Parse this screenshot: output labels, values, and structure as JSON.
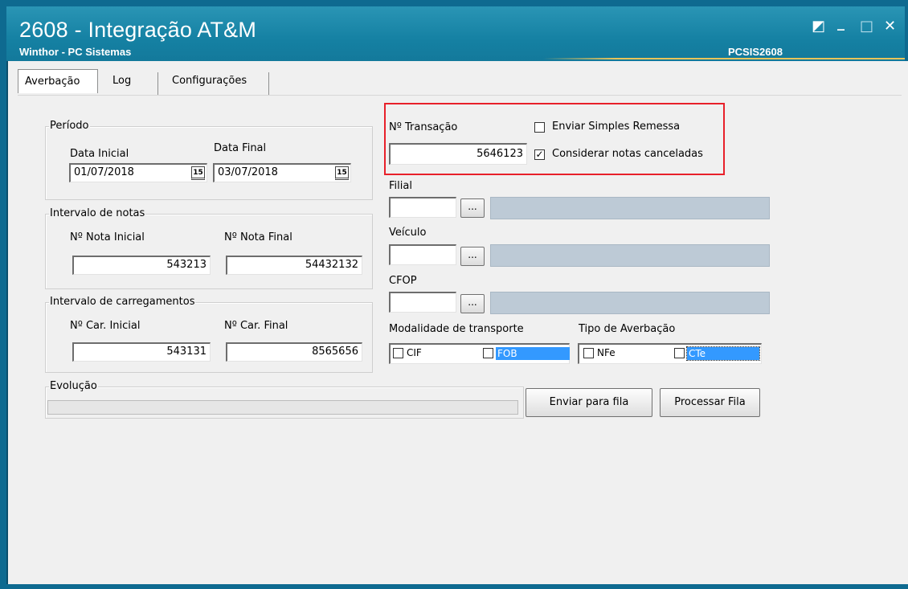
{
  "window": {
    "title": "2608 - Integração AT&M",
    "subtitle": "Winthor - PC Sistemas",
    "code": "PCSIS2608",
    "controls": {
      "restore": "◩",
      "minimize": "_",
      "maximize": "□",
      "close": "✕"
    }
  },
  "tabs": [
    {
      "label": "Averbação",
      "active": true
    },
    {
      "label": "Log",
      "active": false
    },
    {
      "label": "Configurações",
      "active": false
    }
  ],
  "periodo": {
    "legend": "Período",
    "data_inicial_label": "Data Inicial",
    "data_inicial_value": "01/07/2018",
    "data_final_label": "Data Final",
    "data_final_value": "03/07/2018",
    "calendar_glyph": "15"
  },
  "intervalo_notas": {
    "legend": "Intervalo de notas",
    "inicial_label": "Nº Nota Inicial",
    "inicial_value": "543213",
    "final_label": "Nº Nota Final",
    "final_value": "54432132"
  },
  "intervalo_carregamentos": {
    "legend": "Intervalo de carregamentos",
    "inicial_label": "Nº Car. Inicial",
    "inicial_value": "543131",
    "final_label": "Nº Car. Final",
    "final_value": "8565656"
  },
  "evolucao": {
    "legend": "Evolução",
    "progress": 0
  },
  "transacao": {
    "label": "Nº Transação",
    "value": "5646123",
    "enviar_simples_remessa_label": "Enviar Simples Remessa",
    "enviar_simples_remessa_checked": false,
    "considerar_canceladas_label": "Considerar notas canceladas",
    "considerar_canceladas_checked": true,
    "highlight_color": "#e8202a"
  },
  "filial": {
    "label": "Filial",
    "value": "",
    "lookup_label": "..."
  },
  "veiculo": {
    "label": "Veículo",
    "value": "",
    "lookup_label": "..."
  },
  "cfop": {
    "label": "CFOP",
    "value": "",
    "lookup_label": "..."
  },
  "modalidade": {
    "label": "Modalidade de transporte",
    "options": [
      {
        "label": "CIF",
        "checked": false
      },
      {
        "label": "FOB",
        "checked": false
      }
    ]
  },
  "tipo_averbacao": {
    "label": "Tipo de Averbação",
    "options": [
      {
        "label": "NFe",
        "checked": false
      },
      {
        "label": "CTe",
        "checked": false
      }
    ]
  },
  "buttons": {
    "enviar_para_fila": "Enviar para fila",
    "processar_fila": "Processar Fila"
  },
  "colors": {
    "titlebar": "#1581a3",
    "client_bg": "#f0f0f0",
    "selection": "#3399ff",
    "readonly": "#bdcad6"
  }
}
